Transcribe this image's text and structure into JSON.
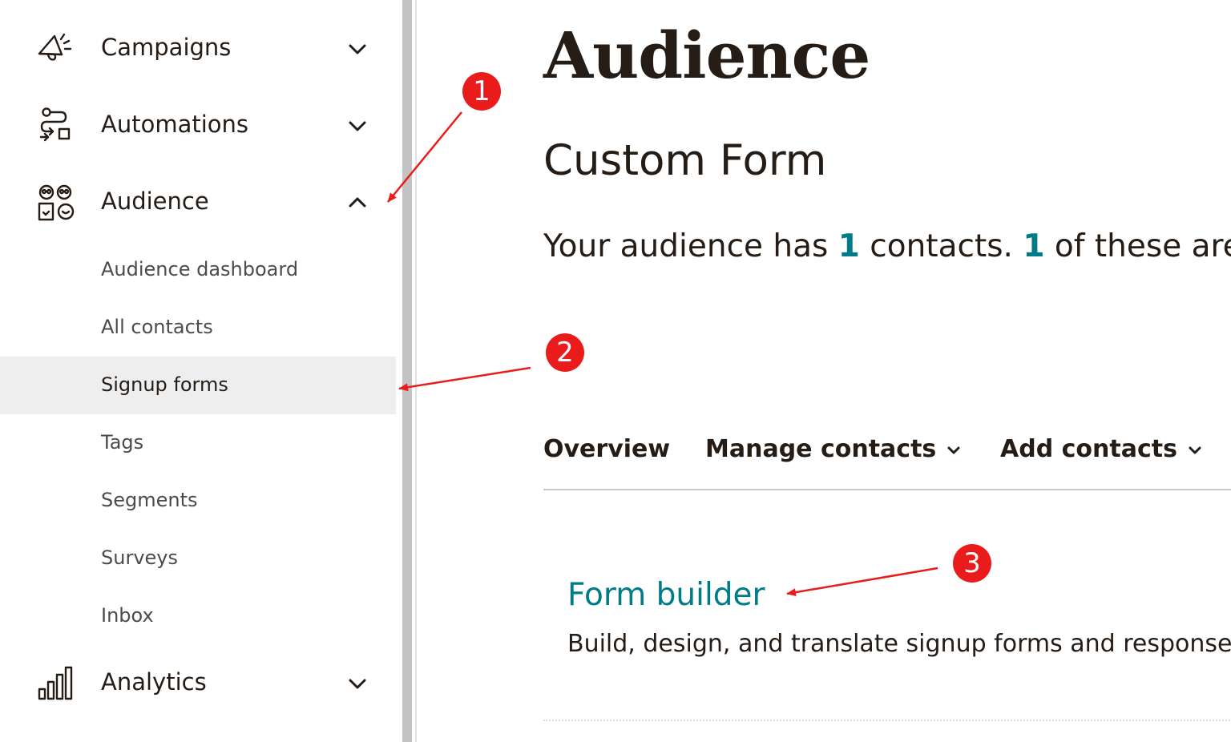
{
  "sidebar": {
    "items": [
      {
        "label": "Campaigns",
        "icon": "megaphone-icon",
        "chevron": "chevron-down-icon"
      },
      {
        "label": "Automations",
        "icon": "automation-flow-icon",
        "chevron": "chevron-down-icon"
      },
      {
        "label": "Audience",
        "icon": "audience-people-icon",
        "chevron": "chevron-up-icon"
      },
      {
        "label": "Analytics",
        "icon": "bar-chart-icon",
        "chevron": "chevron-down-icon"
      }
    ],
    "audience_subitems": [
      {
        "label": "Audience dashboard"
      },
      {
        "label": "All contacts"
      },
      {
        "label": "Signup forms"
      },
      {
        "label": "Tags"
      },
      {
        "label": "Segments"
      },
      {
        "label": "Surveys"
      },
      {
        "label": "Inbox"
      }
    ],
    "active_subitem": "Signup forms"
  },
  "main": {
    "title": "Audience",
    "subtitle": "Custom Form",
    "summary": {
      "prefix": "Your audience has ",
      "total_contacts": "1",
      "middle": " contacts. ",
      "subscribed_count": "1",
      "suffix": " of these are su"
    },
    "tabs": [
      {
        "label": "Overview"
      },
      {
        "label": "Manage contacts"
      },
      {
        "label": "Add contacts"
      }
    ],
    "feature": {
      "link": "Form builder",
      "description": "Build, design, and translate signup forms and response"
    }
  },
  "annotations": [
    {
      "number": "1"
    },
    {
      "number": "2"
    },
    {
      "number": "3"
    }
  ],
  "colors": {
    "accent_link": "#007c89",
    "text": "#241c15",
    "annotation": "#ea1b1b",
    "active_row_bg": "#eeeeee"
  }
}
